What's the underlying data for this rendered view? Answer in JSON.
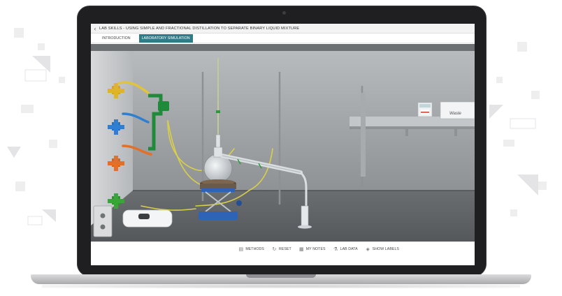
{
  "header": {
    "back_icon": "chevron-left-icon",
    "title": "LAB SKILLS - USING SIMPLE AND FRACTIONAL DISTILLATION TO SEPARATE BINARY LIQUID MIXTURE"
  },
  "tabs": [
    {
      "label": "INTRODUCTION",
      "active": false
    },
    {
      "label": "LABORATORY SIMULATION",
      "active": true
    }
  ],
  "toolbar": {
    "methods": "METHODS",
    "reset": "RESET",
    "my_notes": "MY NOTES",
    "lab_data": "LAB DATA",
    "show_labels": "SHOW LABELS"
  },
  "simulation": {
    "bottle_label": "Boiling Chip",
    "container_label": "Waste"
  },
  "colors": {
    "accent": "#2e7d86",
    "tap_yellow": "#e0b42a",
    "tap_blue": "#2f7fd0",
    "tap_orange": "#e0702a",
    "tap_green": "#3aa33a",
    "condenser_green": "#1f8a3a",
    "lab_jack": "#2f63b8"
  }
}
